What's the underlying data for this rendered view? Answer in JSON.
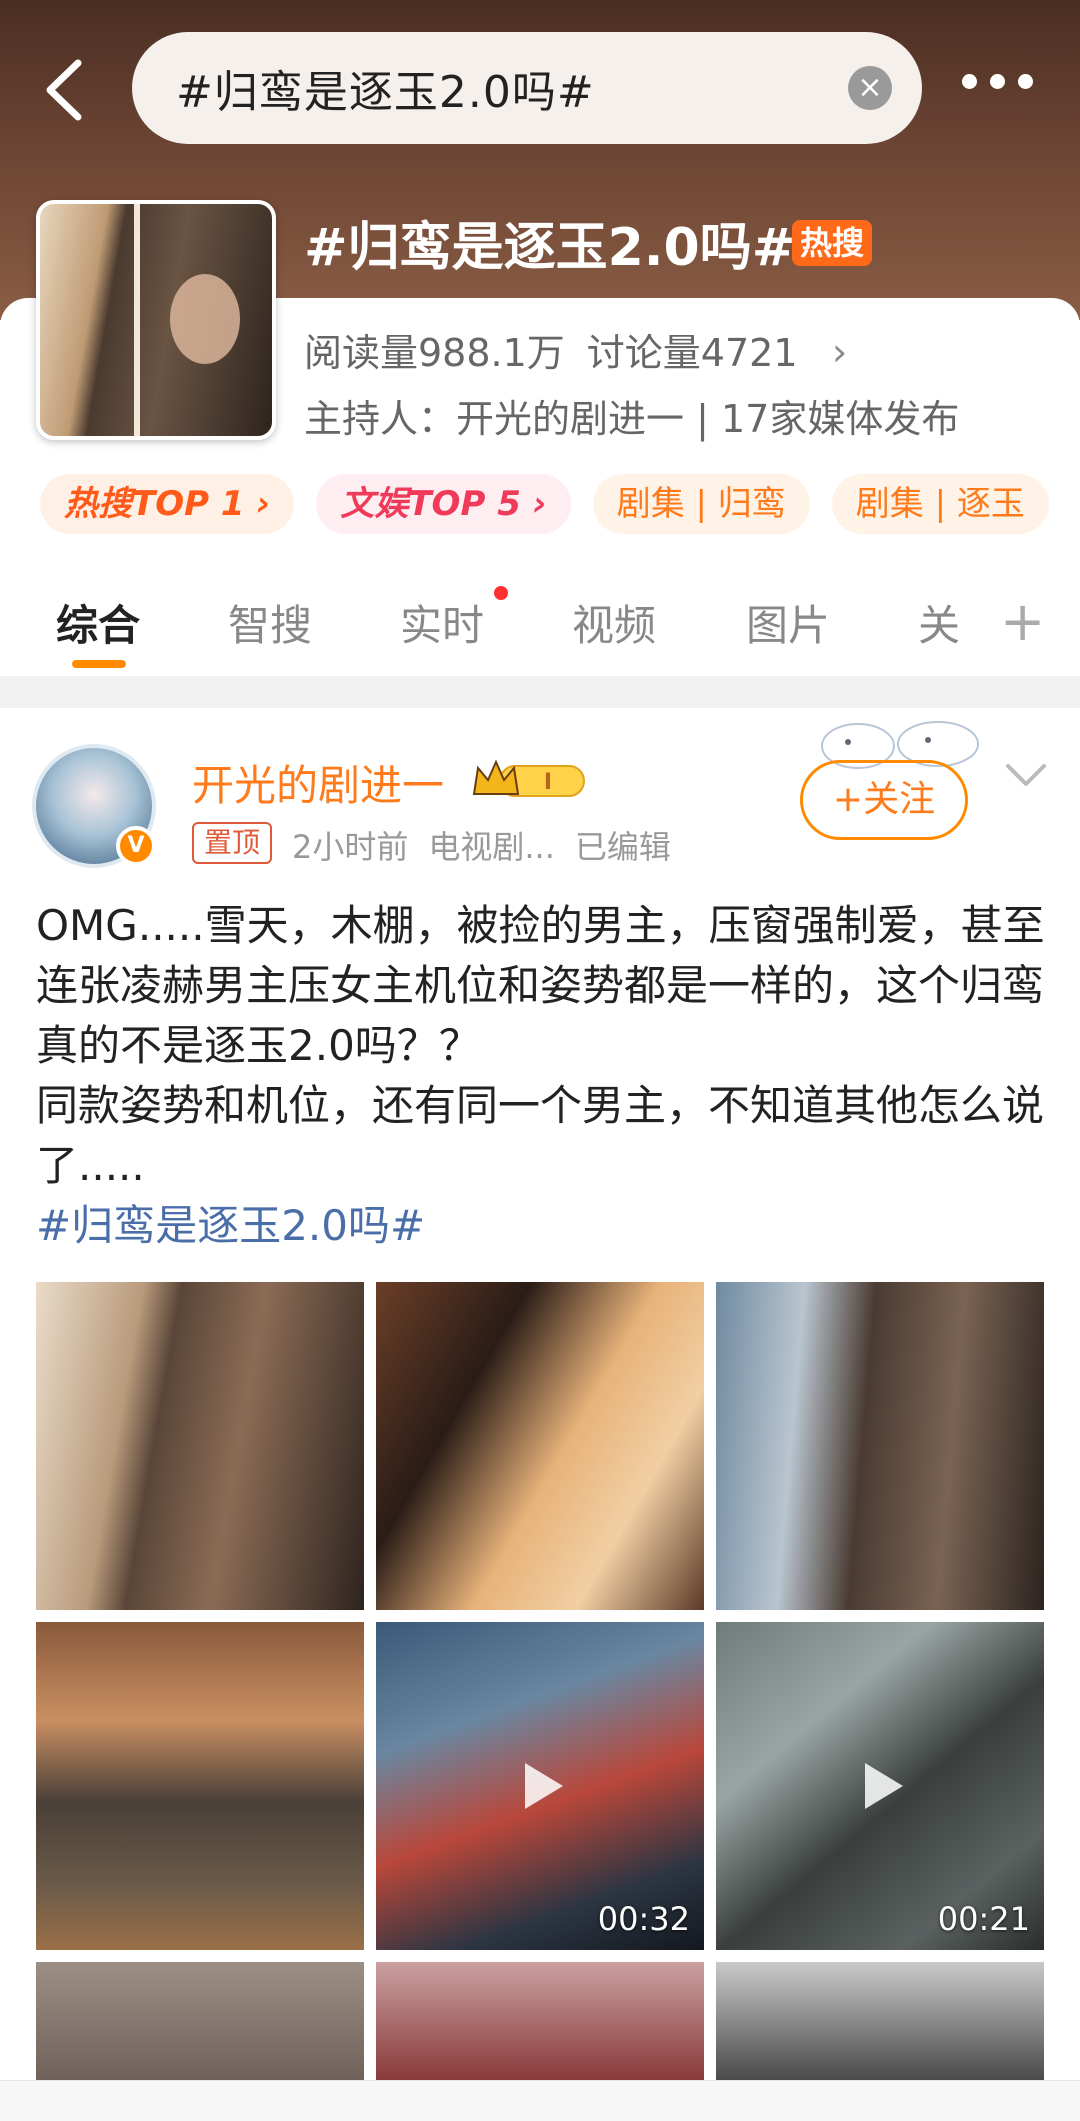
{
  "search": {
    "query": "#归鸾是逐玉2.0吗#"
  },
  "topic": {
    "title": "#归鸾是逐玉2.0吗#",
    "badge": "热搜",
    "reads": "阅读量988.1万",
    "discussions": "讨论量4721",
    "host": "主持人：开光的剧进一 | 17家媒体发布",
    "chips": [
      "热搜TOP 1 ›",
      "文娱TOP 5 ›",
      "剧集 | 归鸾",
      "剧集 | 逐玉"
    ]
  },
  "tabs": [
    "综合",
    "智搜",
    "实时",
    "视频",
    "图片",
    "关"
  ],
  "post": {
    "author": "开光的剧进一",
    "pinned": "置顶",
    "time": "2小时前",
    "source": "电视剧...",
    "edited": "已编辑",
    "follow": "+关注",
    "text_lines": [
      "OMG.....雪天，木棚，被捡的男主，压窗强制爱，甚至连张凌赫男主压女主机位和姿势都是一样的，这个归鸾真的不是逐玉2.0吗？？",
      "同款姿势和机位，还有同一个男主，不知道其他怎么说了....."
    ],
    "hashtag": "#归鸾是逐玉2.0吗#",
    "videos": [
      {
        "duration": "00:32"
      },
      {
        "duration": "00:21"
      }
    ]
  },
  "colors": {
    "accent": "#ff8a00",
    "hashtag": "#4a6ea8",
    "hot": "#ff6a1a"
  }
}
